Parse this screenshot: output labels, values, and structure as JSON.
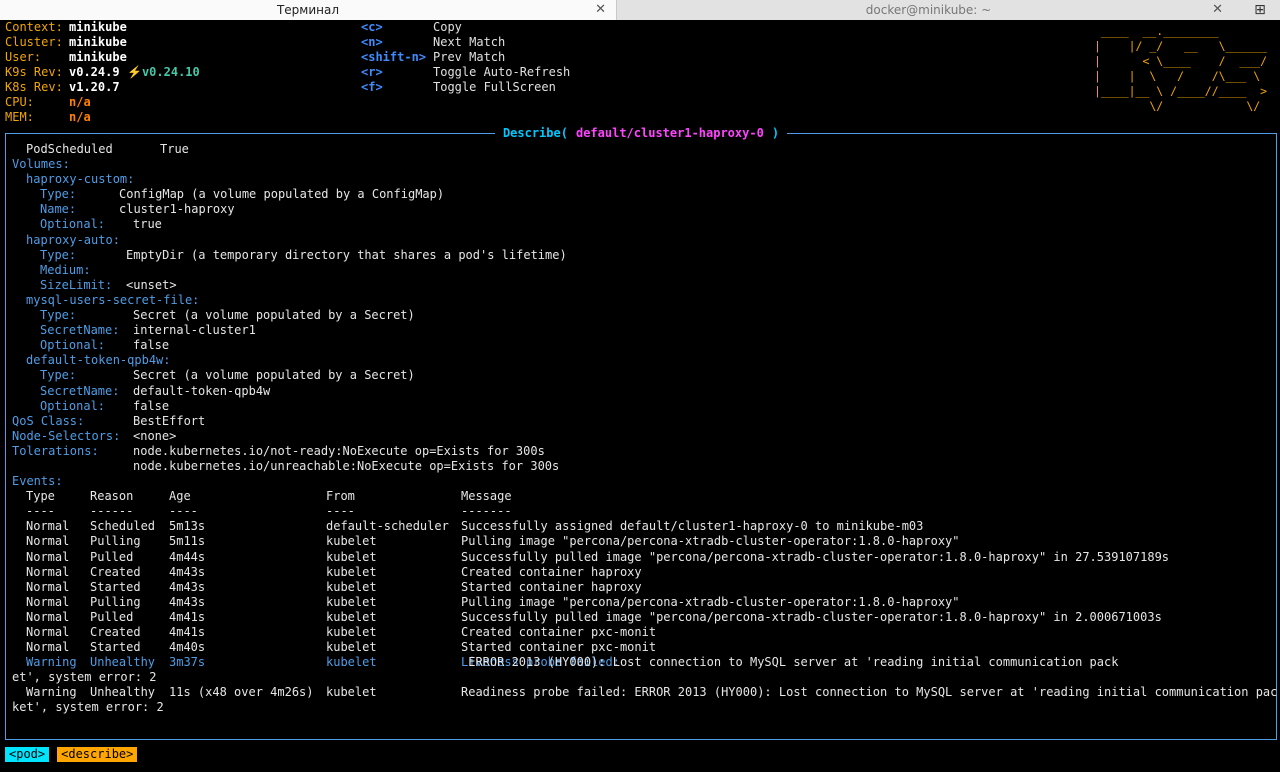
{
  "tabs": [
    {
      "title": "Терминал",
      "active": true
    },
    {
      "title": "docker@minikube: ~",
      "active": false
    }
  ],
  "icons": {
    "close": "close-icon",
    "new_tab": "new-tab-icon"
  },
  "header": {
    "context_label": "Context:",
    "context_value": "minikube",
    "cluster_label": "Cluster:",
    "cluster_value": "minikube",
    "user_label": "User:",
    "user_value": "minikube",
    "k9s_rev_label": "K9s Rev:",
    "k9s_rev_value": "v0.24.9",
    "k9s_update_value": "⚡️v0.24.10",
    "k8s_rev_label": "K8s Rev:",
    "k8s_rev_value": "v1.20.7",
    "cpu_label": "CPU:",
    "cpu_value": "n/a",
    "mem_label": "MEM:",
    "mem_value": "n/a"
  },
  "shortcuts": [
    {
      "key": "<c>",
      "action": "Copy"
    },
    {
      "key": "<n>",
      "action": "Next Match"
    },
    {
      "key": "<shift-n>",
      "action": "Prev Match"
    },
    {
      "key": "<r>",
      "action": "Toggle Auto-Refresh"
    },
    {
      "key": "<f>",
      "action": "Toggle FullScreen"
    }
  ],
  "logo": " ____  __.________\n|    |/ _/   __   \\______\n|      < \\____    /  ___/\n|    |  \\   /    /\\___ \\\n|____|__ \\ /____//____  >\n        \\/            \\/",
  "frame": {
    "title_prefix": "Describe(",
    "title_resource": "default/cluster1-haproxy-0",
    "title_suffix": ")"
  },
  "describe": {
    "pod_scheduled": "PodScheduled",
    "pod_scheduled_value": "True",
    "volumes_label": "Volumes:",
    "haproxy_custom": "haproxy-custom:",
    "type_label": "Type:",
    "name_label": "Name:",
    "optional_label": "Optional:",
    "medium_label": "Medium:",
    "sizelimit_label": "SizeLimit:",
    "secretname_label": "SecretName:",
    "hc_type": "ConfigMap (a volume populated by a ConfigMap)",
    "hc_name": "cluster1-haproxy",
    "hc_optional": "true",
    "haproxy_auto": "haproxy-auto:",
    "ha_type": "EmptyDir (a temporary directory that shares a pod's lifetime)",
    "ha_sizelimit": "<unset>",
    "mysql_secret": "mysql-users-secret-file:",
    "ms_type": "Secret (a volume populated by a Secret)",
    "ms_secretname": "internal-cluster1",
    "ms_optional": "false",
    "default_token": "default-token-qpb4w:",
    "dt_type": "Secret (a volume populated by a Secret)",
    "dt_secretname": "default-token-qpb4w",
    "dt_optional": "false",
    "qos_label": "QoS Class:",
    "qos_value": "BestEffort",
    "nodesel_label": "Node-Selectors:",
    "nodesel_value": "<none>",
    "tol_label": "Tolerations:",
    "tol_1": "node.kubernetes.io/not-ready:NoExecute op=Exists for 300s",
    "tol_2": "node.kubernetes.io/unreachable:NoExecute op=Exists for 300s",
    "events_label": "Events:"
  },
  "events": {
    "columns": [
      "Type",
      "Reason",
      "Age",
      "From",
      "Message"
    ],
    "separators": [
      "----",
      "------",
      "----",
      "----",
      "-------"
    ],
    "rows": [
      [
        "Normal",
        "Scheduled",
        "5m13s",
        "default-scheduler",
        "Successfully assigned default/cluster1-haproxy-0 to minikube-m03"
      ],
      [
        "Normal",
        "Pulling",
        "5m11s",
        "kubelet",
        "Pulling image \"percona/percona-xtradb-cluster-operator:1.8.0-haproxy\""
      ],
      [
        "Normal",
        "Pulled",
        "4m44s",
        "kubelet",
        "Successfully pulled image \"percona/percona-xtradb-cluster-operator:1.8.0-haproxy\" in 27.539107189s"
      ],
      [
        "Normal",
        "Created",
        "4m43s",
        "kubelet",
        "Created container haproxy"
      ],
      [
        "Normal",
        "Started",
        "4m43s",
        "kubelet",
        "Started container haproxy"
      ],
      [
        "Normal",
        "Pulling",
        "4m43s",
        "kubelet",
        "Pulling image \"percona/percona-xtradb-cluster-operator:1.8.0-haproxy\""
      ],
      [
        "Normal",
        "Pulled",
        "4m41s",
        "kubelet",
        "Successfully pulled image \"percona/percona-xtradb-cluster-operator:1.8.0-haproxy\" in 2.000671003s"
      ],
      [
        "Normal",
        "Created",
        "4m41s",
        "kubelet",
        "Created container pxc-monit"
      ],
      [
        "Normal",
        "Started",
        "4m40s",
        "kubelet",
        "Started container pxc-monit"
      ]
    ],
    "warning1": {
      "type": "Warning",
      "reason": "Unhealthy",
      "age": "3m37s",
      "from": "kubelet",
      "message_head": "Liveness probe failed:",
      "message_tail": " ERROR 2013 (HY000): Lost connection to MySQL server at 'reading initial communication pack",
      "wrap": "et', system error: 2"
    },
    "warning2": {
      "type": "Warning",
      "reason": "Unhealthy",
      "age": "11s (x48 over 4m26s)",
      "from": "kubelet",
      "message": "Readiness probe failed: ERROR 2013 (HY000): Lost connection to MySQL server at 'reading initial communication pac",
      "wrap": "ket', system error: 2"
    }
  },
  "crumbs": [
    "<pod>",
    "<describe>"
  ]
}
